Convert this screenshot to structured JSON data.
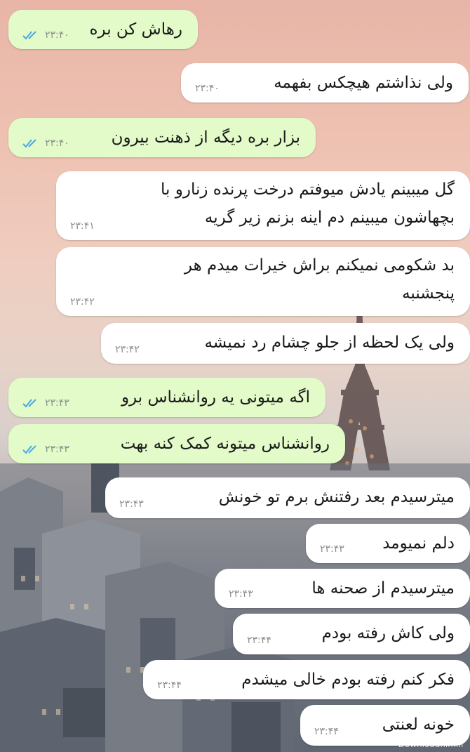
{
  "messages": [
    {
      "text": "رهاش کن بره",
      "time": "۲۳:۴۰",
      "read_icon": "double-check-icon"
    },
    {
      "text": "ولی نذاشتم هیچکس بفهمه",
      "time": "۲۳:۴۰"
    },
    {
      "text": "بزار بره دیگه از ذهنت بیرون",
      "time": "۲۳:۴۰",
      "read_icon": "double-check-icon"
    },
    {
      "line1": "گل میبینم یادش میوفتم درخت پرنده زنارو با",
      "line2": "بچهاشون میبینم دم اینه بزنم زیر گریه",
      "time": "۲۳:۴۱"
    },
    {
      "line1": "بد شکومی نمیکنم براش خیرات میدم هر",
      "line2": "پنجشنبه",
      "time": "۲۳:۴۲"
    },
    {
      "text": "ولی یک لحظه از جلو چشام رد نمیشه",
      "time": "۲۳:۴۲"
    },
    {
      "text": "اگه میتونی یه روانشناس برو",
      "time": "۲۳:۴۳",
      "read_icon": "double-check-icon"
    },
    {
      "text": "روانشناس میتونه کمک کنه بهت",
      "time": "۲۳:۴۳",
      "read_icon": "double-check-icon"
    },
    {
      "text": "میترسیدم بعد رفتنش برم تو خونش",
      "time": "۲۳:۴۳"
    },
    {
      "text": "دلم نمیومد",
      "time": "۲۳:۴۳"
    },
    {
      "text": "میترسیدم از صحنه ها",
      "time": "۲۳:۴۳"
    },
    {
      "text": "ولی کاش رفته بودم",
      "time": "۲۳:۴۴"
    },
    {
      "text": "فکر کنم رفته بودم خالی میشدم",
      "time": "۲۳:۴۴"
    },
    {
      "text": "خونه لعنتی",
      "time": "۲۳:۴۴"
    }
  ],
  "colors": {
    "outgoing": "#e2fbc9",
    "incoming": "#ffffff",
    "ticks": "#4aa8e8"
  },
  "watermark": "Downloadfilm.ir"
}
